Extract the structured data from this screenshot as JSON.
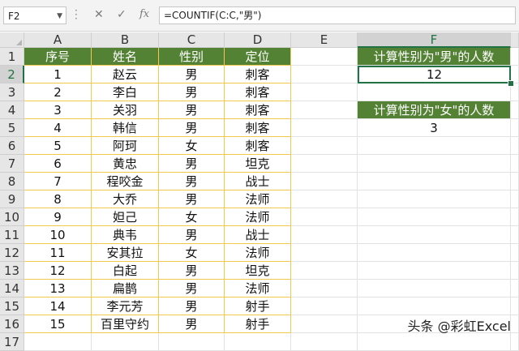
{
  "formula_bar": {
    "name_box": "F2",
    "formula": "=COUNTIF(C:C,\"男\")",
    "cancel_glyph": "✕",
    "enter_glyph": "✓",
    "fx_label": "fx"
  },
  "columns": [
    "A",
    "B",
    "C",
    "D",
    "E",
    "F"
  ],
  "selected_column": "F",
  "selected_row": "2",
  "row_numbers": [
    "1",
    "2",
    "3",
    "4",
    "5",
    "6",
    "7",
    "8",
    "9",
    "10",
    "11",
    "12",
    "13",
    "14",
    "15",
    "16",
    "17"
  ],
  "table": {
    "headers": [
      "序号",
      "姓名",
      "性别",
      "定位"
    ],
    "rows": [
      [
        "1",
        "赵云",
        "男",
        "刺客"
      ],
      [
        "2",
        "李白",
        "男",
        "刺客"
      ],
      [
        "3",
        "关羽",
        "男",
        "刺客"
      ],
      [
        "4",
        "韩信",
        "男",
        "刺客"
      ],
      [
        "5",
        "阿珂",
        "女",
        "刺客"
      ],
      [
        "6",
        "黄忠",
        "男",
        "坦克"
      ],
      [
        "7",
        "程咬金",
        "男",
        "战士"
      ],
      [
        "8",
        "大乔",
        "男",
        "法师"
      ],
      [
        "9",
        "妲己",
        "女",
        "法师"
      ],
      [
        "10",
        "典韦",
        "男",
        "战士"
      ],
      [
        "11",
        "安其拉",
        "女",
        "法师"
      ],
      [
        "12",
        "白起",
        "男",
        "坦克"
      ],
      [
        "13",
        "扁鹊",
        "男",
        "法师"
      ],
      [
        "14",
        "李元芳",
        "男",
        "射手"
      ],
      [
        "15",
        "百里守约",
        "男",
        "射手"
      ]
    ]
  },
  "summary": {
    "male_label": "计算性别为\"男\"的人数",
    "male_value": "12",
    "female_label": "计算性别为\"女\"的人数",
    "female_value": "3"
  },
  "watermark": "头条 @彩虹Excel",
  "colors": {
    "header_fill": "#548235",
    "selection": "#217346",
    "table_border": "#f2c94c"
  }
}
